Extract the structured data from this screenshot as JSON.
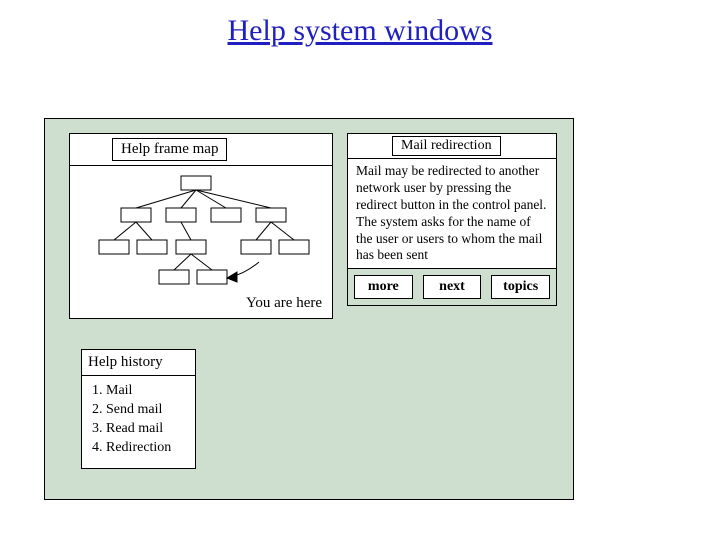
{
  "page": {
    "title": "Help system windows"
  },
  "frame_map": {
    "title": "Help frame map",
    "you_are_here": "You are here"
  },
  "mail": {
    "title": "Mail redirection",
    "body": "Mail may be redirected to another network user by pressing the redirect button in the control panel. The system asks for the name of the user or users to whom the mail has been sent",
    "buttons": {
      "more": "more",
      "next": "next",
      "topics": "topics"
    }
  },
  "history": {
    "title": "Help history",
    "items": [
      {
        "n": "1.",
        "label": "Mail"
      },
      {
        "n": "2.",
        "label": "Send mail"
      },
      {
        "n": "3.",
        "label": "Read mail"
      },
      {
        "n": "4.",
        "label": "Redirection"
      }
    ]
  }
}
